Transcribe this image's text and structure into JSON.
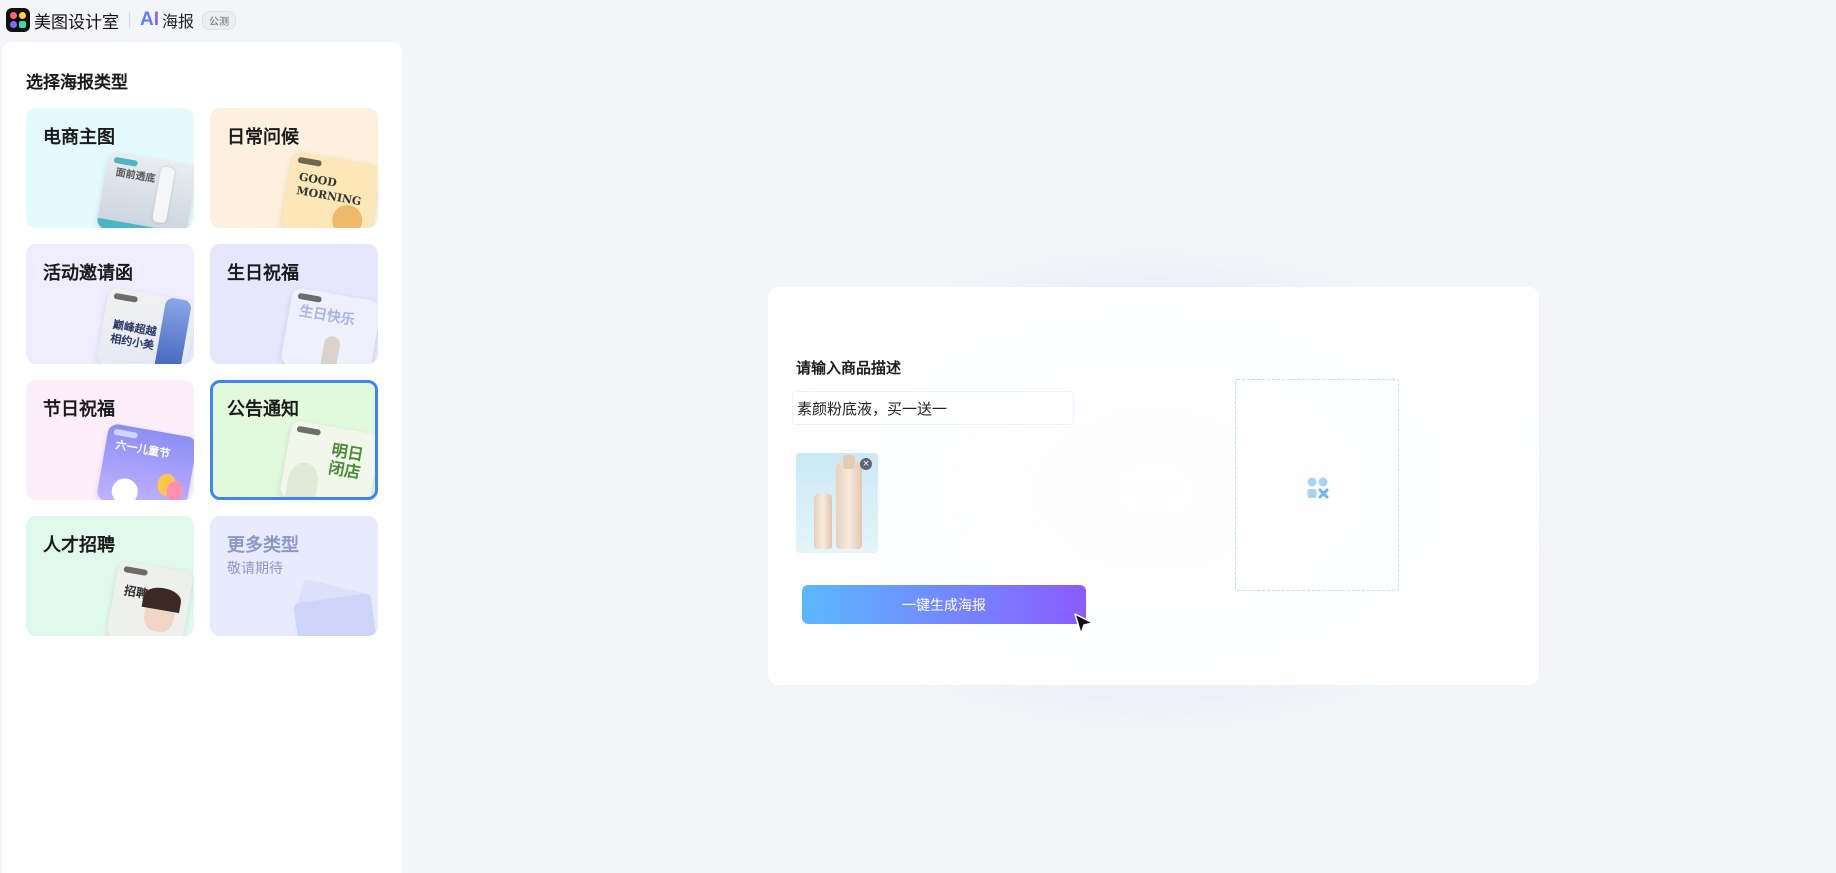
{
  "header": {
    "brand_name": "美图设计室",
    "ai_mark": "AI",
    "ai_label": "海报",
    "beta_badge": "公测"
  },
  "sidebar": {
    "title": "选择海报类型",
    "cards": [
      {
        "title": "电商主图",
        "thumb_text": "面前透底",
        "bg": "#e3fbfd",
        "selected": false
      },
      {
        "title": "日常问候",
        "thumb_text": "GOOD MORNING",
        "bg": "#fdf0dc",
        "selected": false
      },
      {
        "title": "活动邀请函",
        "thumb_text": "巅峰超越 相约小美",
        "bg": "#efedff",
        "selected": false
      },
      {
        "title": "生日祝福",
        "thumb_text": "生日快乐",
        "bg": "#e6e6ff",
        "selected": false
      },
      {
        "title": "节日祝福",
        "thumb_text": "六一儿童节",
        "bg": "#fdeefb",
        "selected": false
      },
      {
        "title": "公告通知",
        "thumb_text": "明日闭店",
        "bg": "#e3f9dc",
        "selected": true
      },
      {
        "title": "人才招聘",
        "thumb_text": "招聘",
        "bg": "#dff9ec",
        "selected": false
      },
      {
        "title": "更多类型",
        "subtitle": "敬请期待",
        "bg": "#e7ebfb",
        "selected": false
      }
    ]
  },
  "main": {
    "desc_label": "请输入商品描述",
    "desc_value": "素颜粉底液，买一送一",
    "generate_label": "一键生成海报"
  },
  "colors": {
    "accent_blue": "#3d84f7",
    "button_gradient_start": "#5bb8ff",
    "button_gradient_end": "#8a5cff"
  }
}
